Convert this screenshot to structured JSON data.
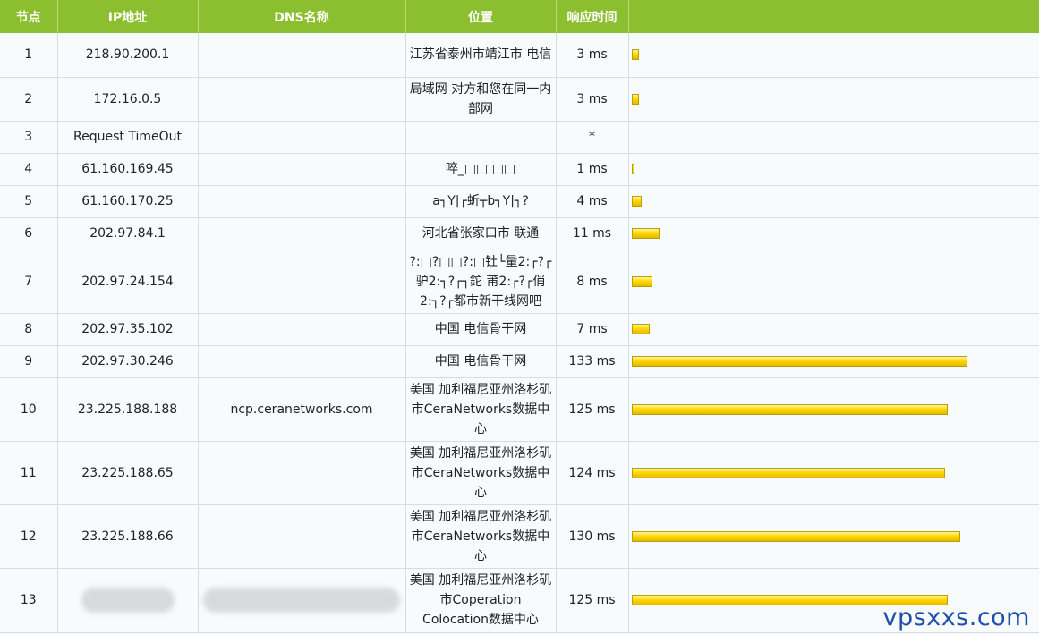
{
  "headers": {
    "hop": "节点",
    "ip": "IP地址",
    "dns": "DNS名称",
    "location": "位置",
    "rtt": "响应时间",
    "bar": ""
  },
  "colors": {
    "header_bg": "#8bbf2f",
    "bar": "#ffd800",
    "watermark": "#1f4fa8"
  },
  "rows": [
    {
      "hop": "1",
      "ip": "218.90.200.1",
      "dns": "",
      "location": "江苏省泰州市靖江市 电信",
      "rtt": "3 ms",
      "rtt_ms": 3
    },
    {
      "hop": "2",
      "ip": "172.16.0.5",
      "dns": "",
      "location": "局域网 对方和您在同一内部网",
      "rtt": "3 ms",
      "rtt_ms": 3
    },
    {
      "hop": "3",
      "ip": "Request TimeOut",
      "dns": "",
      "location": "",
      "rtt": "*",
      "rtt_ms": 0
    },
    {
      "hop": "4",
      "ip": "61.160.169.45",
      "dns": "",
      "location": "啐_□□ □□",
      "rtt": "1 ms",
      "rtt_ms": 1
    },
    {
      "hop": "5",
      "ip": "61.160.170.25",
      "dns": "",
      "location": "a┐Y|┌蚚┬b┐Y|┐?",
      "rtt": "4 ms",
      "rtt_ms": 4
    },
    {
      "hop": "6",
      "ip": "202.97.84.1",
      "dns": "",
      "location": "河北省张家口市 联通",
      "rtt": "11 ms",
      "rtt_ms": 11
    },
    {
      "hop": "7",
      "ip": "202.97.24.154",
      "dns": "",
      "location": "?:□?□□?:□钍└量2:┌?┌驴2:┐?┌┐鉈 莆2:┌?┌俏2:┐?┌都市新干线网吧",
      "rtt": "8 ms",
      "rtt_ms": 8
    },
    {
      "hop": "8",
      "ip": "202.97.35.102",
      "dns": "",
      "location": "中国 电信骨干网",
      "rtt": "7 ms",
      "rtt_ms": 7
    },
    {
      "hop": "9",
      "ip": "202.97.30.246",
      "dns": "",
      "location": "中国 电信骨干网",
      "rtt": "133 ms",
      "rtt_ms": 133
    },
    {
      "hop": "10",
      "ip": "23.225.188.188",
      "dns": "ncp.ceranetworks.com",
      "location": "美国 加利福尼亚州洛杉矶市CeraNetworks数据中心",
      "rtt": "125 ms",
      "rtt_ms": 125
    },
    {
      "hop": "11",
      "ip": "23.225.188.65",
      "dns": "",
      "location": "美国 加利福尼亚州洛杉矶市CeraNetworks数据中心",
      "rtt": "124 ms",
      "rtt_ms": 124
    },
    {
      "hop": "12",
      "ip": "23.225.188.66",
      "dns": "",
      "location": "美国 加利福尼亚州洛杉矶市CeraNetworks数据中心",
      "rtt": "130 ms",
      "rtt_ms": 130
    },
    {
      "hop": "13",
      "ip": "",
      "dns": "",
      "location": "美国 加利福尼亚州洛杉矶市Coperation Colocation数据中心",
      "rtt": "125 ms",
      "rtt_ms": 125,
      "redacted": true
    }
  ],
  "watermark": "vpsxxs.com"
}
